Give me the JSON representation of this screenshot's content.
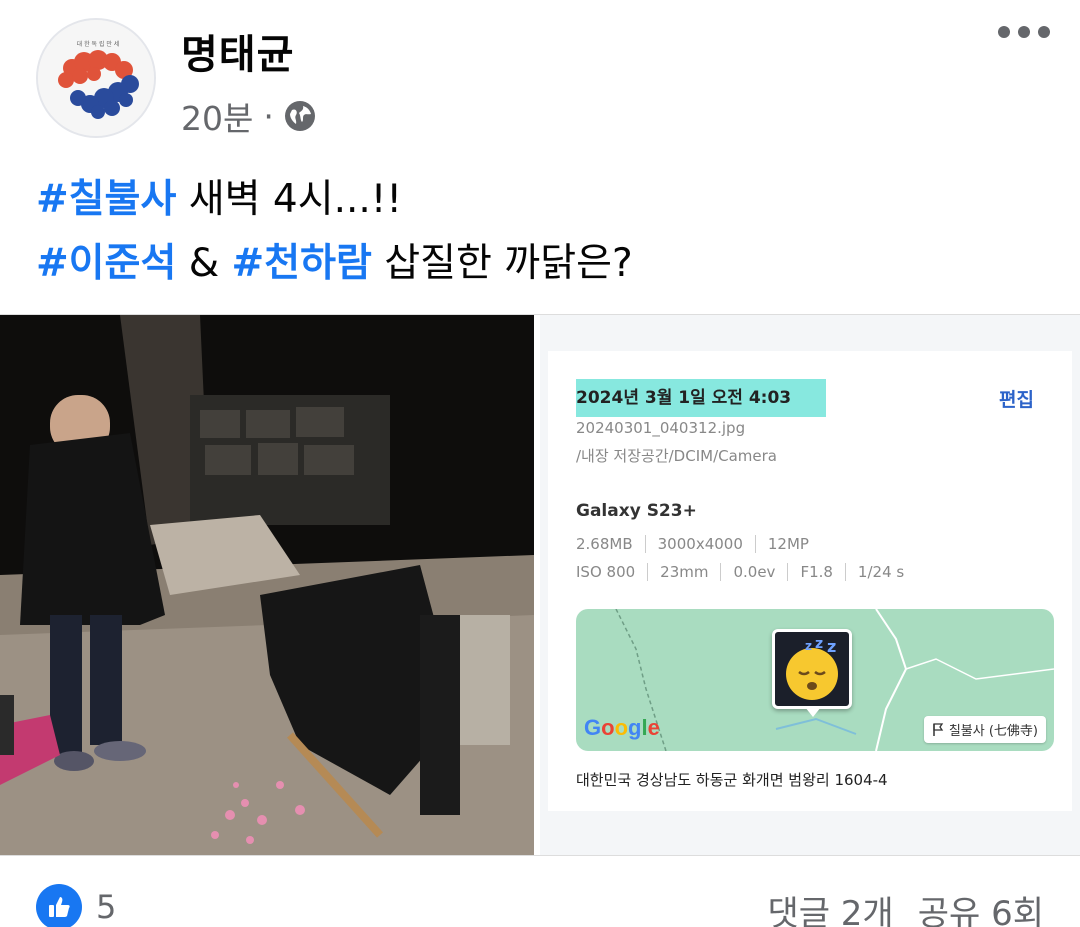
{
  "post": {
    "author": "명태균",
    "time": "20분",
    "separator": "·",
    "privacy_icon": "globe-icon",
    "more_icon": "more-options-icon",
    "line1": {
      "hashtag": "#칠불사",
      "text": " 새벽 4시...!!"
    },
    "line2": {
      "hashtag1": "#이준석",
      "amp": " & ",
      "hashtag2": "#천하람",
      "text": " 삽질한 까닭은?"
    }
  },
  "photo_info": {
    "date": "2024년 3월 1일 오전 4:03",
    "edit_label": "편집",
    "filename": "20240301_040312.jpg",
    "path": "/내장 저장공간/DCIM/Camera",
    "device": "Galaxy S23+",
    "specs_row1": [
      "2.68MB",
      "3000x4000",
      "12MP"
    ],
    "specs_row2": [
      "ISO 800",
      "23mm",
      "0.0ev",
      "F1.8",
      "1/24 s"
    ],
    "map_logo": "Google",
    "place_label": "칠불사 (七佛寺)",
    "address": "대한민국 경상남도 하동군 화개면 범왕리 1604-4"
  },
  "footer": {
    "like_count": "5",
    "comments": "댓글 2개",
    "shares": "공유 6회"
  },
  "colors": {
    "hashtag": "#1877f2",
    "highlight": "#5fe0d4",
    "map": "#a9dcc0",
    "like": "#1877f2"
  }
}
